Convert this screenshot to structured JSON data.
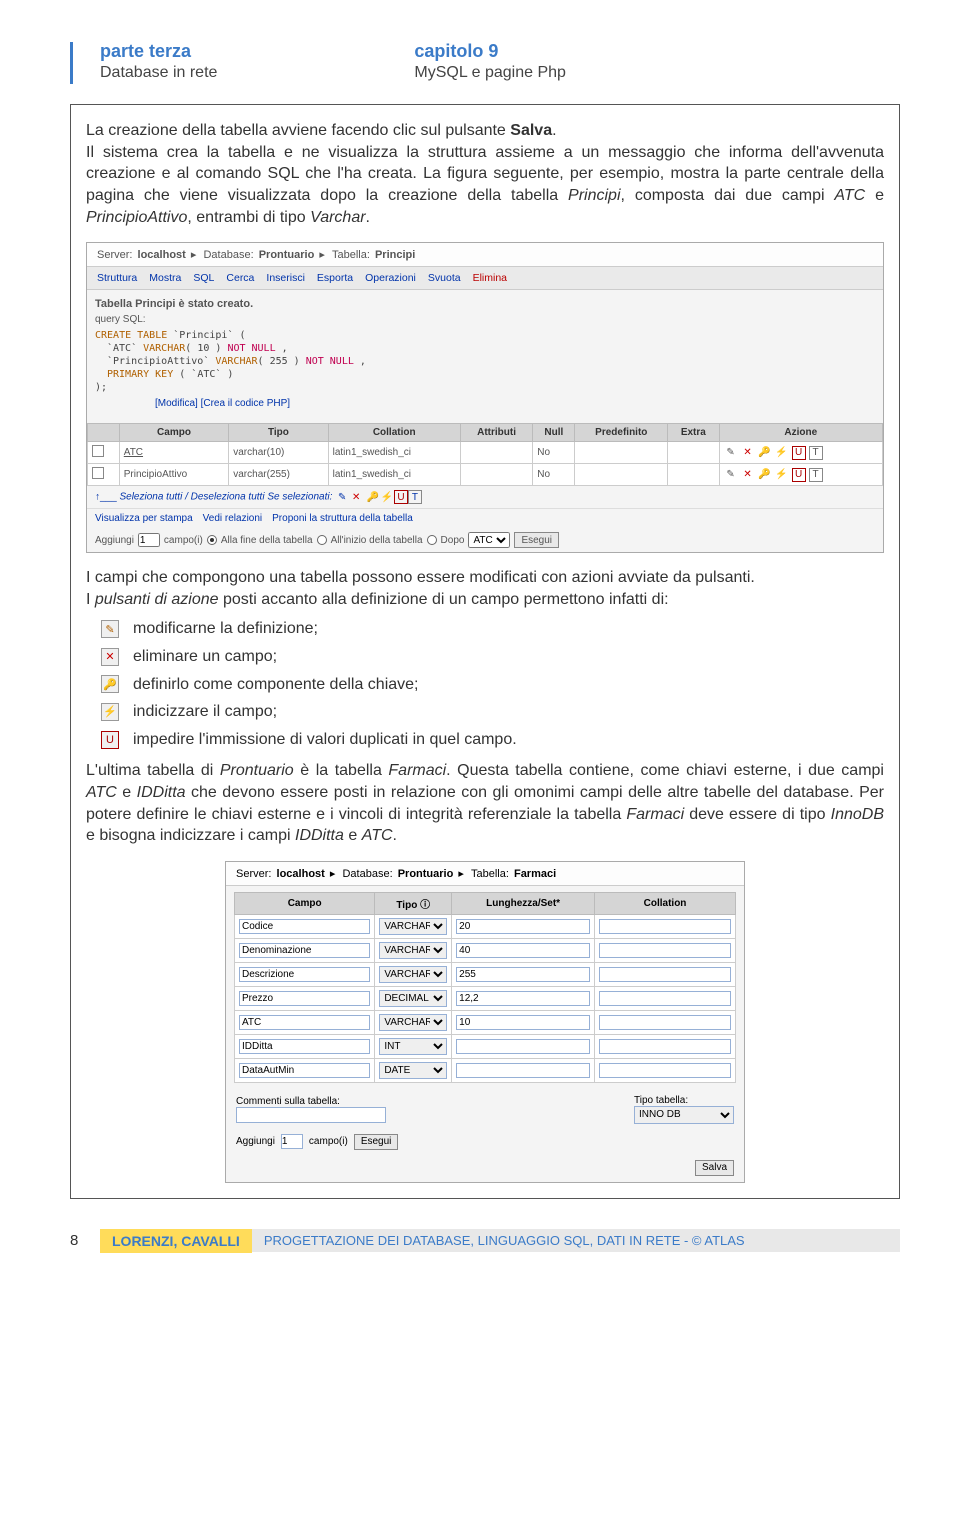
{
  "header": {
    "left_title": "parte terza",
    "left_sub": "Database in rete",
    "right_title": "capitolo 9",
    "right_sub": "MySQL e pagine Php"
  },
  "para1": "La creazione della tabella avviene facendo clic sul pulsante ",
  "para1_bold": "Salva",
  "para1_end": ".",
  "para2": "Il sistema crea la tabella e ne visualizza la struttura assieme a un messaggio che informa dell'avvenuta creazione e al comando SQL che l'ha creata. La figura seguente, per esempio, mostra la parte centrale della pagina che viene visualizzata dopo la creazione della tabella ",
  "para2_i1": "Principi",
  "para2_mid": ", composta dai due campi ",
  "para2_i2": "ATC",
  "para2_mid2": " e ",
  "para2_i3": "PrincipioAttivo",
  "para2_end": ", entrambi di tipo ",
  "para2_i4": "Varchar",
  "para2_dot": ".",
  "ss1": {
    "crumb": [
      "Server:",
      "localhost",
      "▸",
      "Database:",
      "Prontuario",
      "▸",
      "Tabella:",
      "Principi"
    ],
    "tabs": [
      "Struttura",
      "Mostra",
      "SQL",
      "Cerca",
      "Inserisci",
      "Esporta",
      "Operazioni",
      "Svuota",
      "Elimina"
    ],
    "msg": "Tabella Principi è stato creato.",
    "query_label": "query SQL:",
    "query": {
      "l1": "CREATE TABLE `Principi` (",
      "l2": "`ATC` VARCHAR( 10 ) NOT NULL ,",
      "l3": "`PrincipioAttivo` VARCHAR( 255 ) NOT NULL ,",
      "l4": "PRIMARY KEY ( `ATC` )",
      "l5": ");"
    },
    "links": "[Modifica] [Crea il codice PHP]",
    "cols": [
      "Campo",
      "Tipo",
      "Collation",
      "Attributi",
      "Null",
      "Predefinito",
      "Extra",
      "Azione"
    ],
    "rows": [
      {
        "campo": "ATC",
        "tipo": "varchar(10)",
        "coll": "latin1_swedish_ci",
        "nul": "No"
      },
      {
        "campo": "PrincipioAttivo",
        "tipo": "varchar(255)",
        "coll": "latin1_swedish_ci",
        "nul": "No"
      }
    ],
    "selectall": "Seleziona tutti / Deseleziona tutti   Se selezionati:",
    "blinks": [
      "Visualizza per stampa",
      "Vedi relazioni",
      "Proponi la struttura della tabella"
    ],
    "add": {
      "label": "Aggiungi",
      "n": "1",
      "campo": "campo(i)",
      "r1": "Alla fine della tabella",
      "r2": "All'inizio della tabella",
      "r3": "Dopo",
      "sel": "ATC",
      "btn": "Esegui"
    }
  },
  "para3": "I campi che compongono una tabella possono essere modificati con azioni avviate da pulsanti.",
  "para4a": "I ",
  "para4_i": "pulsanti di azione",
  "para4b": " posti accanto alla definizione di un campo permettono infatti di:",
  "actions": [
    {
      "icon": "✎",
      "text": "modificarne la definizione;"
    },
    {
      "icon": "✕",
      "text": "eliminare un campo;"
    },
    {
      "icon": "🔑",
      "text": "definirlo come componente della chiave;"
    },
    {
      "icon": "⚡",
      "text": "indicizzare il campo;"
    },
    {
      "icon": "U",
      "text": "impedire l'immissione di valori duplicati in quel campo."
    }
  ],
  "para5a": "L'ultima tabella di ",
  "para5_i1": "Prontuario",
  "para5b": " è la tabella ",
  "para5_i2": "Farmaci",
  "para5c": ". Questa tabella contiene, come chiavi esterne, i due campi ",
  "para5_i3": "ATC",
  "para5d": " e ",
  "para5_i4": "IDDitta",
  "para5e": " che devono essere posti in relazione con gli omonimi campi delle altre tabelle del database. Per potere definire le chiavi esterne e i vincoli di integrità referenziale la tabella ",
  "para5_i5": "Farmaci",
  "para5f": " deve essere di tipo ",
  "para5_i6": "InnoDB",
  "para5g": " e bisogna indicizzare i campi ",
  "para5_i7": "IDDitta",
  "para5h": " e ",
  "para5_i8": "ATC",
  "para5i": ".",
  "ss2": {
    "crumb": [
      "Server:",
      "localhost",
      "▸",
      "Database:",
      "Prontuario",
      "▸",
      "Tabella:",
      "Farmaci"
    ],
    "cols": [
      "Campo",
      "Tipo ⓘ",
      "Lunghezza/Set*",
      "Collation"
    ],
    "rows": [
      {
        "campo": "Codice",
        "tipo": "VARCHAR",
        "len": "20"
      },
      {
        "campo": "Denominazione",
        "tipo": "VARCHAR",
        "len": "40"
      },
      {
        "campo": "Descrizione",
        "tipo": "VARCHAR",
        "len": "255"
      },
      {
        "campo": "Prezzo",
        "tipo": "DECIMAL",
        "len": "12,2"
      },
      {
        "campo": "ATC",
        "tipo": "VARCHAR",
        "len": "10"
      },
      {
        "campo": "IDDitta",
        "tipo": "INT",
        "len": ""
      },
      {
        "campo": "DataAutMin",
        "tipo": "DATE",
        "len": ""
      }
    ],
    "comm_label": "Commenti sulla tabella:",
    "tipo_label": "Tipo tabella:",
    "tipo_val": "INNO DB",
    "add_label": "Aggiungi",
    "add_n": "1",
    "add_campo": "campo(i)",
    "add_btn": "Esegui",
    "save": "Salva"
  },
  "footer": {
    "num": "8",
    "author": "LORENZI, CAVALLI",
    "title": "PROGETTAZIONE DEI DATABASE, LINGUAGGIO SQL, DATI IN RETE - © ATLAS"
  }
}
